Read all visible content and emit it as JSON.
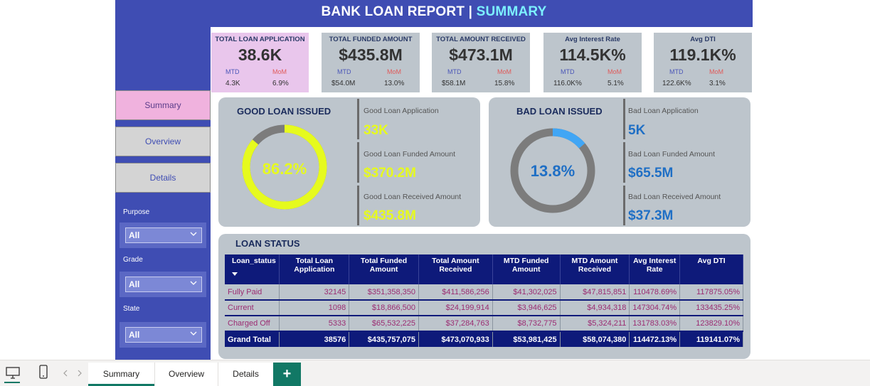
{
  "title": {
    "main": "BANK LOAN REPORT",
    "sep": "|",
    "accent": "SUMMARY"
  },
  "nav": {
    "summary": "Summary",
    "overview": "Overview",
    "details": "Details"
  },
  "filters": [
    {
      "label": "Purpose",
      "value": "All"
    },
    {
      "label": "Grade",
      "value": "All"
    },
    {
      "label": "State",
      "value": "All"
    }
  ],
  "kpis": [
    {
      "label": "TOTAL LOAN APPLICATION",
      "value": "38.6K",
      "mtd_label": "MTD",
      "mom_label": "MoM",
      "mtd": "4.3K",
      "mom": "6.9%"
    },
    {
      "label": "TOTAL FUNDED AMOUNT",
      "value": "$435.8M",
      "mtd_label": "MTD",
      "mom_label": "MoM",
      "mtd": "$54.0M",
      "mom": "13.0%"
    },
    {
      "label": "TOTAL AMOUNT RECEIVED",
      "value": "$473.1M",
      "mtd_label": "MTD",
      "mom_label": "MoM",
      "mtd": "$58.1M",
      "mom": "15.8%"
    },
    {
      "label": "Avg Interest Rate",
      "value": "114.5K%",
      "mtd_label": "MTD",
      "mom_label": "MoM",
      "mtd": "116.0K%",
      "mom": "5.1%"
    },
    {
      "label": "Avg DTI",
      "value": "119.1K%",
      "mtd_label": "MTD",
      "mom_label": "MoM",
      "mtd": "122.6K%",
      "mom": "3.1%"
    }
  ],
  "good": {
    "title": "GOOD LOAN ISSUED",
    "pct_label": "86.2%",
    "pct": 0.862,
    "app_label": "Good Loan Application",
    "app": "33K",
    "funded_label": "Good Loan Funded Amount",
    "funded": "$370.2M",
    "received_label": "Good Loan Received Amount",
    "received": "$435.8M",
    "color": "#e6fa1e"
  },
  "bad": {
    "title": "BAD LOAN ISSUED",
    "pct_label": "13.8%",
    "pct": 0.138,
    "app_label": "Bad Loan Application",
    "app": "5K",
    "funded_label": "Bad Loan Funded Amount",
    "funded": "$65.5M",
    "received_label": "Bad Loan Received Amount",
    "received": "$37.3M",
    "color": "#1f6fc5"
  },
  "status": {
    "title": "LOAN STATUS",
    "headers": [
      "Loan_status",
      "Total Loan Application",
      "Total Funded Amount",
      "Total Amount Received",
      "MTD Funded Amount",
      "MTD Amount Received",
      "Avg Interest Rate",
      "Avg DTI"
    ],
    "rows": [
      [
        "Fully Paid",
        "32145",
        "$351,358,350",
        "$411,586,256",
        "$41,302,025",
        "$47,815,851",
        "110478.69%",
        "117875.05%"
      ],
      [
        "Current",
        "1098",
        "$18,866,500",
        "$24,199,914",
        "$3,946,625",
        "$4,934,318",
        "147304.74%",
        "133435.25%"
      ],
      [
        "Charged Off",
        "5333",
        "$65,532,225",
        "$37,284,763",
        "$8,732,775",
        "$5,324,211",
        "131783.03%",
        "123829.10%"
      ]
    ],
    "total": [
      "Grand Total",
      "38576",
      "$435,757,075",
      "$473,070,933",
      "$53,981,425",
      "$58,074,380",
      "114472.13%",
      "119141.07%"
    ]
  },
  "tabs": {
    "summary": "Summary",
    "overview": "Overview",
    "details": "Details",
    "add": "+"
  }
}
